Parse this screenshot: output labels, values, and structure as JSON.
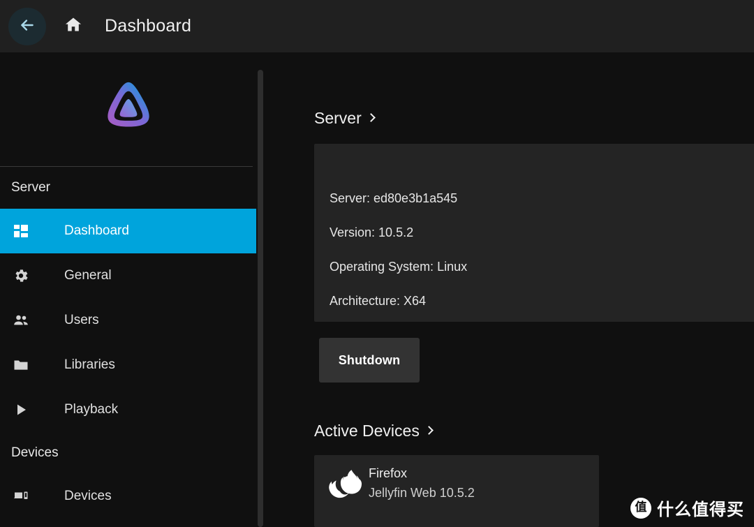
{
  "header": {
    "back_icon": "arrow-left-icon",
    "home_icon": "home-icon",
    "title": "Dashboard",
    "accent_back_color": "#a9d9ea",
    "background": "#202020"
  },
  "sidebar": {
    "logo_icon": "jellyfin-logo-icon",
    "logo_gradient_from": "#aa5cc3",
    "logo_gradient_to": "#00a4dc",
    "active_color": "#00a4dc",
    "sections": [
      {
        "label": "Server",
        "items": [
          {
            "label": "Dashboard",
            "icon": "dashboard-grid-icon",
            "active": true
          },
          {
            "label": "General",
            "icon": "gear-icon",
            "active": false
          },
          {
            "label": "Users",
            "icon": "people-icon",
            "active": false
          },
          {
            "label": "Libraries",
            "icon": "folder-icon",
            "active": false
          },
          {
            "label": "Playback",
            "icon": "play-triangle-icon",
            "active": false
          }
        ]
      },
      {
        "label": "Devices",
        "items": [
          {
            "label": "Devices",
            "icon": "devices-icon",
            "active": false
          }
        ]
      }
    ]
  },
  "main": {
    "server_section": {
      "heading": "Server",
      "chevron_icon": "chevron-right-icon",
      "card_background": "#242424",
      "lines": [
        "Server: ed80e3b1a545",
        "Version: 10.5.2",
        "Operating System: Linux",
        "Architecture: X64"
      ]
    },
    "shutdown_button": {
      "label": "Shutdown",
      "background": "#333333"
    },
    "active_devices_section": {
      "heading": "Active Devices",
      "chevron_icon": "chevron-right-icon",
      "devices": [
        {
          "icon": "firefox-icon",
          "name": "Firefox",
          "client": "Jellyfin Web 10.5.2"
        }
      ]
    }
  },
  "watermark": {
    "logo_glyph": "值",
    "text": "什么值得买"
  }
}
